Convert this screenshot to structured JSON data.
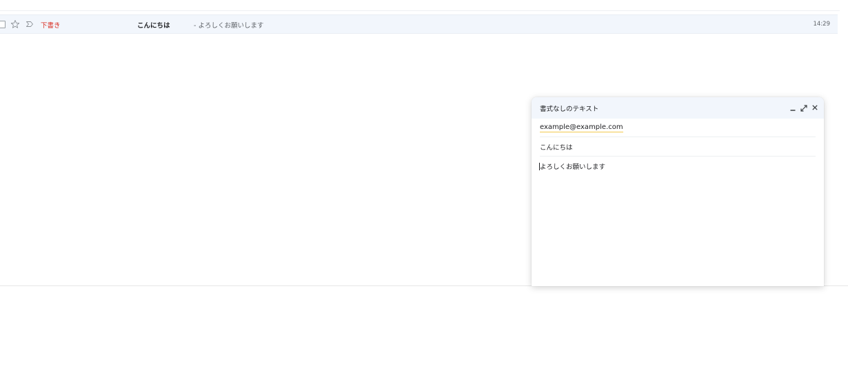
{
  "mail_list": {
    "row": {
      "draft_label": "下書き",
      "subject": "こんにちは",
      "snippet": " - よろしくお願いします",
      "time": "14:29"
    }
  },
  "compose": {
    "title": "書式なしのテキスト",
    "to": "example@example.com",
    "subject": "こんにちは",
    "body": "よろしくお願いします"
  },
  "colors": {
    "draft": "#d93025",
    "row_background": "#f2f6fc",
    "header_background": "#f2f6fc"
  },
  "icons": {
    "row_checkbox": "checkbox-icon",
    "row_star": "star-icon",
    "row_important": "important-icon",
    "minimize": "minimize-icon",
    "expand": "expand-icon",
    "close": "close-icon"
  }
}
